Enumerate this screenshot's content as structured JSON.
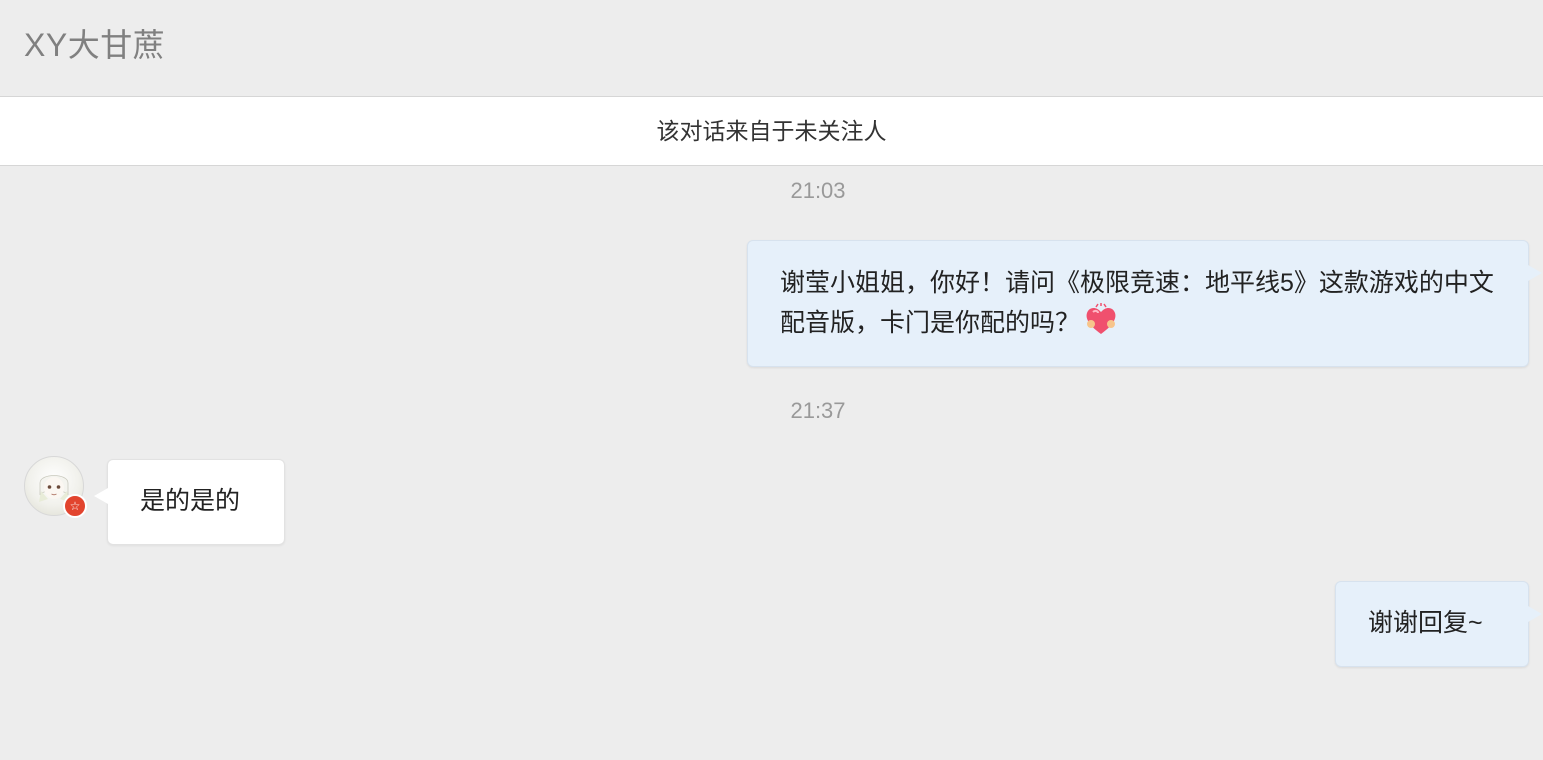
{
  "header": {
    "title": "XY大甘蔗"
  },
  "notice": {
    "text": "该对话来自于未关注人"
  },
  "messages": [
    {
      "timestamp": "21:03",
      "direction": "outgoing",
      "text": "谢莹小姐姐，你好！请问《极限竞速：地平线5》这款游戏的中文配音版，卡门是你配的吗？",
      "emoji": "heart-hugging-emoji"
    },
    {
      "timestamp": "21:37",
      "direction": "incoming",
      "text": "是的是的"
    },
    {
      "direction": "outgoing",
      "text": "谢谢回复~"
    }
  ],
  "avatar": {
    "badge_icon": "star-badge-icon",
    "badge_color": "#e2442e"
  },
  "colors": {
    "background": "#ededed",
    "outgoing_bubble": "#e6f0fa",
    "incoming_bubble": "#ffffff",
    "timestamp": "#999999",
    "title": "#808080"
  }
}
